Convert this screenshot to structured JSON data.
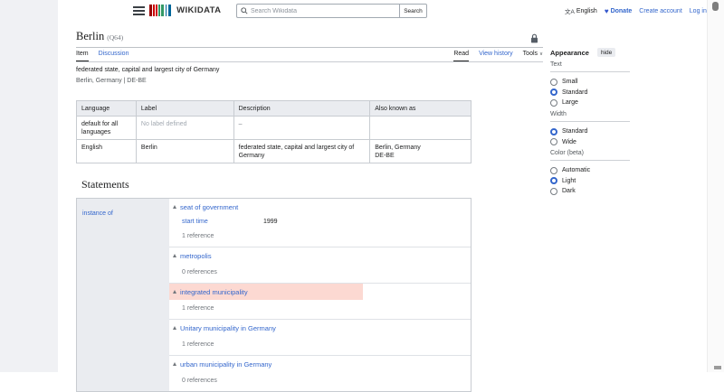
{
  "header": {
    "logo_text": "WIKIDATA",
    "search_placeholder": "Search Wikidata",
    "search_button": "Search",
    "language_label": "English",
    "language_icon": "文A",
    "donate_label": "Donate",
    "create_account": "Create account",
    "login": "Log in"
  },
  "page": {
    "title": "Berlin",
    "entity_id": "(Q64)",
    "tabs": {
      "item": "Item",
      "discussion": "Discussion",
      "read": "Read",
      "view_history": "View history",
      "tools": "Tools"
    },
    "description": "federated state, capital and largest city of Germany",
    "aliases_line": "Berlin, Germany | DE-BE"
  },
  "terms_table": {
    "headers": [
      "Language",
      "Label",
      "Description",
      "Also known as"
    ],
    "rows": [
      {
        "language": "default for all languages",
        "label": "No label defined",
        "label_muted": true,
        "description": "–",
        "aliases": ""
      },
      {
        "language": "English",
        "label": "Berlin",
        "description": "federated state, capital and largest city of Germany",
        "aliases": "Berlin, Germany\nDE-BE"
      }
    ]
  },
  "statements": {
    "heading": "Statements",
    "property": "instance of",
    "claims": [
      {
        "value": "seat of government",
        "qualifier_property": "start time",
        "qualifier_value": "1999",
        "references": "1 reference"
      },
      {
        "value": "metropolis",
        "references": "0 references"
      },
      {
        "value": "integrated municipality",
        "references": "1 reference",
        "highlight": true
      },
      {
        "value": "Unitary municipality in Germany",
        "references": "1 reference"
      },
      {
        "value": "urban municipality in Germany",
        "references": "0 references"
      }
    ]
  },
  "appearance": {
    "title": "Appearance",
    "hide_button": "hide",
    "text_label": "Text",
    "text_options": [
      {
        "label": "Small"
      },
      {
        "label": "Standard",
        "selected": true
      },
      {
        "label": "Large"
      }
    ],
    "width_label": "Width",
    "width_options": [
      {
        "label": "Standard",
        "selected": true
      },
      {
        "label": "Wide"
      }
    ],
    "color_label": "Color (beta)",
    "color_options": [
      {
        "label": "Automatic"
      },
      {
        "label": "Light",
        "selected": true
      },
      {
        "label": "Dark"
      }
    ]
  },
  "colors": {
    "link_blue": "#3366cc",
    "statement_highlight_pink": "#fcd9d2",
    "radio_selected_blue": "#3366cc",
    "table_header_gray": "#eaecf0",
    "logo_red": "#990000",
    "logo_green": "#339966",
    "logo_blue": "#006699"
  }
}
